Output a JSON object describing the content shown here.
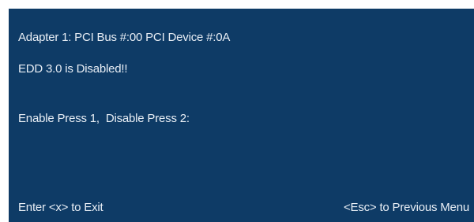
{
  "screen": {
    "adapter_line": "Adapter 1: PCI Bus #:00 PCI Device #:0A",
    "status_line": "EDD 3.0 is Disabled!!",
    "prompt_line": "Enable Press 1,  Disable Press 2:"
  },
  "footer": {
    "exit_hint": "Enter <x> to Exit",
    "previous_menu_hint": "<Esc> to Previous Menu"
  },
  "colors": {
    "background": "#0e3b66",
    "text": "#e8eef5"
  }
}
